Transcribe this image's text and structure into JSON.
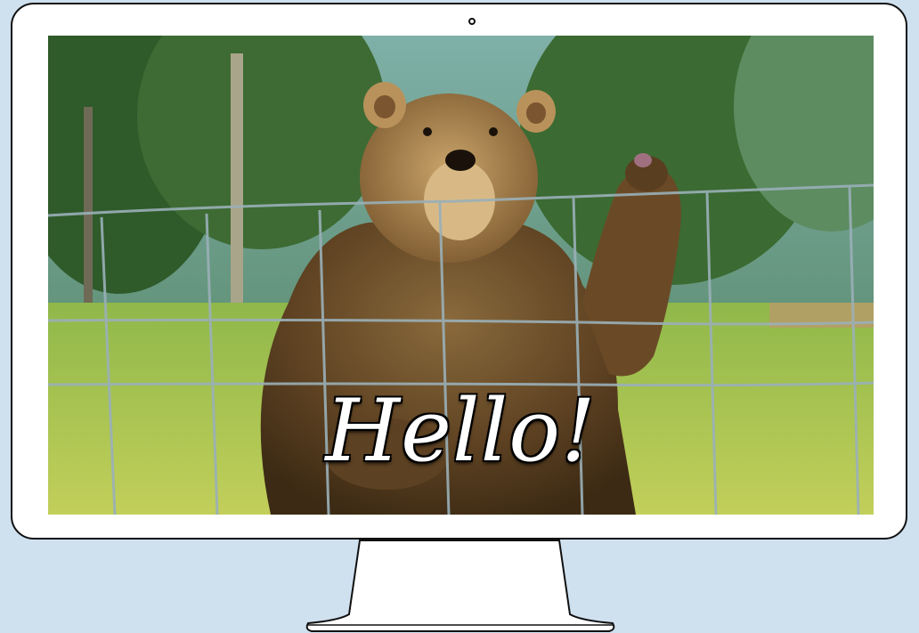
{
  "screen": {
    "caption": "Hello!"
  },
  "colors": {
    "background": "#cfe0ef",
    "monitor_frame": "#ffffff",
    "outline": "#111111",
    "caption_fill": "#ffffff"
  },
  "icons": {
    "camera": "camera-dot-icon"
  }
}
